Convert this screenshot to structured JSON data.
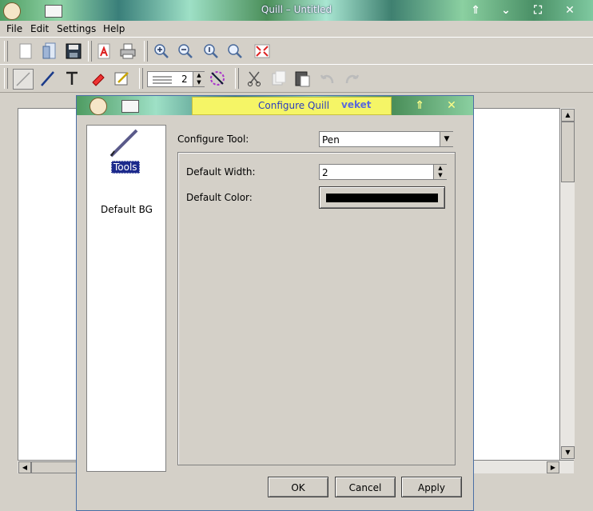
{
  "window": {
    "title": "Quill – Untitled"
  },
  "menu": {
    "items": [
      "File",
      "Edit",
      "Settings",
      "Help"
    ]
  },
  "toolbar2": {
    "width_value": "2"
  },
  "dialog": {
    "title": "Configure Quill",
    "tag": "veket",
    "sidebar": {
      "tools_label": "Tools",
      "bg_label": "Default BG"
    },
    "configure_tool_label": "Configure Tool:",
    "configure_tool_value": "Pen",
    "default_width_label": "Default Width:",
    "default_width_value": "2",
    "default_color_label": "Default Color:",
    "default_color": "#000000",
    "buttons": {
      "ok": "OK",
      "cancel": "Cancel",
      "apply": "Apply"
    }
  }
}
